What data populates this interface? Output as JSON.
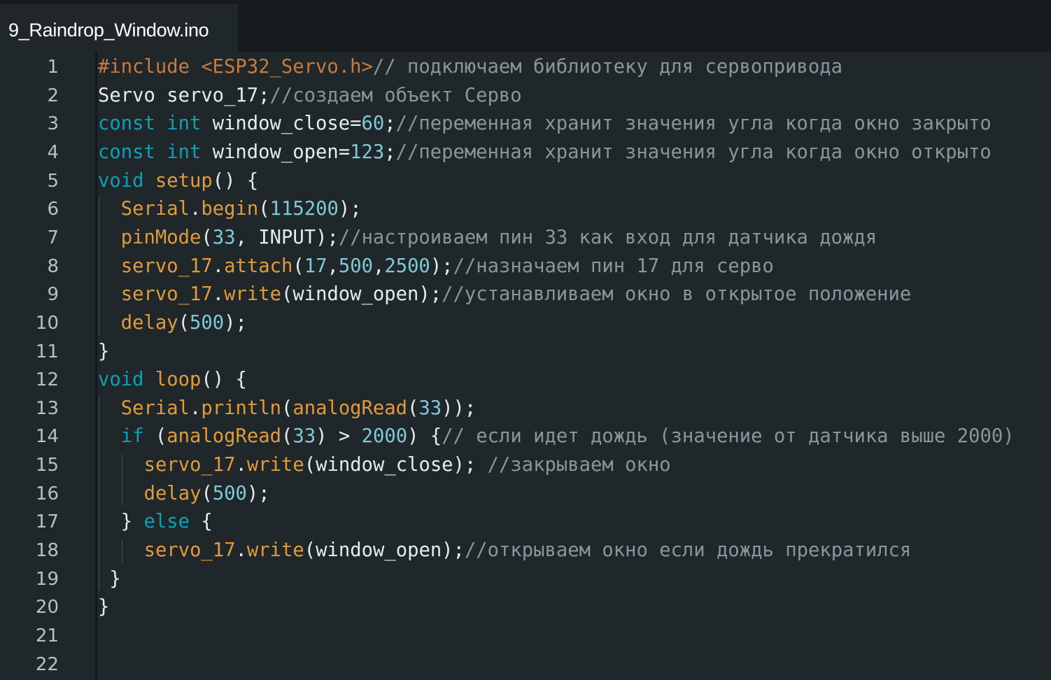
{
  "tab": {
    "title": "9_Raindrop_Window.ino"
  },
  "colors": {
    "keyword": "#0ea1b5",
    "preprocessor": "#cb7a3d",
    "function": "#e19a3c",
    "number": "#7fcad6",
    "comment": "#8a959b",
    "text": "#e6ecee",
    "background": "#1f272b"
  },
  "lines": [
    {
      "n": "1",
      "indent": 0,
      "tokens": [
        [
          "pp",
          "#include <ESP32_Servo.h>"
        ],
        [
          "cm",
          "// подключаем библиотеку для сервопривода"
        ]
      ]
    },
    {
      "n": "2",
      "indent": 0,
      "tokens": [
        [
          "df",
          "Servo servo_17;"
        ],
        [
          "cm",
          "//создаем объект Серво"
        ]
      ]
    },
    {
      "n": "3",
      "indent": 0,
      "tokens": [
        [
          "kw",
          "const"
        ],
        [
          "df",
          " "
        ],
        [
          "kw",
          "int"
        ],
        [
          "df",
          " window_close="
        ],
        [
          "num",
          "60"
        ],
        [
          "df",
          ";"
        ],
        [
          "cm",
          "//переменная хранит значения угла когда окно закрыто"
        ]
      ]
    },
    {
      "n": "4",
      "indent": 0,
      "tokens": [
        [
          "kw",
          "const"
        ],
        [
          "df",
          " "
        ],
        [
          "kw",
          "int"
        ],
        [
          "df",
          " window_open="
        ],
        [
          "num",
          "123"
        ],
        [
          "df",
          ";"
        ],
        [
          "cm",
          "//переменная хранит значения угла когда окно открыто"
        ]
      ]
    },
    {
      "n": "5",
      "indent": 0,
      "tokens": [
        [
          "kw",
          "void"
        ],
        [
          "df",
          " "
        ],
        [
          "fn",
          "setup"
        ],
        [
          "df",
          "() {"
        ]
      ]
    },
    {
      "n": "6",
      "indent": 2,
      "tokens": [
        [
          "fn",
          "Serial"
        ],
        [
          "df",
          "."
        ],
        [
          "fn",
          "begin"
        ],
        [
          "df",
          "("
        ],
        [
          "num",
          "115200"
        ],
        [
          "df",
          ");"
        ]
      ]
    },
    {
      "n": "7",
      "indent": 2,
      "tokens": [
        [
          "fn",
          "pinMode"
        ],
        [
          "df",
          "("
        ],
        [
          "num",
          "33"
        ],
        [
          "df",
          ", INPUT);"
        ],
        [
          "cm",
          "//настроиваем пин 33 как вход для датчика дождя"
        ]
      ]
    },
    {
      "n": "8",
      "indent": 2,
      "tokens": [
        [
          "fn",
          "servo_17"
        ],
        [
          "df",
          "."
        ],
        [
          "fn",
          "attach"
        ],
        [
          "df",
          "("
        ],
        [
          "num",
          "17"
        ],
        [
          "df",
          ","
        ],
        [
          "num",
          "500"
        ],
        [
          "df",
          ","
        ],
        [
          "num",
          "2500"
        ],
        [
          "df",
          ");"
        ],
        [
          "cm",
          "//назначаем пин 17 для серво"
        ]
      ]
    },
    {
      "n": "9",
      "indent": 2,
      "tokens": [
        [
          "fn",
          "servo_17"
        ],
        [
          "df",
          "."
        ],
        [
          "fn",
          "write"
        ],
        [
          "df",
          "(window_open);"
        ],
        [
          "cm",
          "//устанавливаем окно в открытое положение"
        ]
      ]
    },
    {
      "n": "10",
      "indent": 2,
      "tokens": [
        [
          "fn",
          "delay"
        ],
        [
          "df",
          "("
        ],
        [
          "num",
          "500"
        ],
        [
          "df",
          ");"
        ]
      ]
    },
    {
      "n": "11",
      "indent": 0,
      "tokens": [
        [
          "df",
          "}"
        ]
      ]
    },
    {
      "n": "12",
      "indent": 0,
      "tokens": [
        [
          "kw",
          "void"
        ],
        [
          "df",
          " "
        ],
        [
          "fn",
          "loop"
        ],
        [
          "df",
          "() {"
        ]
      ]
    },
    {
      "n": "13",
      "indent": 2,
      "tokens": [
        [
          "fn",
          "Serial"
        ],
        [
          "df",
          "."
        ],
        [
          "fn",
          "println"
        ],
        [
          "df",
          "("
        ],
        [
          "fn",
          "analogRead"
        ],
        [
          "df",
          "("
        ],
        [
          "num",
          "33"
        ],
        [
          "df",
          "));"
        ]
      ]
    },
    {
      "n": "14",
      "indent": 2,
      "tokens": [
        [
          "kw",
          "if"
        ],
        [
          "df",
          " ("
        ],
        [
          "fn",
          "analogRead"
        ],
        [
          "df",
          "("
        ],
        [
          "num",
          "33"
        ],
        [
          "df",
          ") > "
        ],
        [
          "num",
          "2000"
        ],
        [
          "df",
          ") {"
        ],
        [
          "cm",
          "// если идет дождь (значение от датчика выше 2000)"
        ]
      ]
    },
    {
      "n": "15",
      "indent": 4,
      "tokens": [
        [
          "fn",
          "servo_17"
        ],
        [
          "df",
          "."
        ],
        [
          "fn",
          "write"
        ],
        [
          "df",
          "(window_close); "
        ],
        [
          "cm",
          "//закрываем окно"
        ]
      ]
    },
    {
      "n": "16",
      "indent": 4,
      "tokens": [
        [
          "fn",
          "delay"
        ],
        [
          "df",
          "("
        ],
        [
          "num",
          "500"
        ],
        [
          "df",
          ");"
        ]
      ]
    },
    {
      "n": "17",
      "indent": 2,
      "tokens": [
        [
          "df",
          "} "
        ],
        [
          "kw",
          "else"
        ],
        [
          "df",
          " {"
        ]
      ]
    },
    {
      "n": "18",
      "indent": 4,
      "tokens": [
        [
          "fn",
          "servo_17"
        ],
        [
          "df",
          "."
        ],
        [
          "fn",
          "write"
        ],
        [
          "df",
          "(window_open);"
        ],
        [
          "cm",
          "//открываем окно если дождь прекратился"
        ]
      ]
    },
    {
      "n": "19",
      "indent": 1,
      "tokens": [
        [
          "df",
          "}"
        ]
      ]
    },
    {
      "n": "20",
      "indent": 0,
      "tokens": [
        [
          "df",
          "}"
        ]
      ]
    },
    {
      "n": "21",
      "indent": 0,
      "tokens": []
    },
    {
      "n": "22",
      "indent": 0,
      "tokens": []
    }
  ]
}
